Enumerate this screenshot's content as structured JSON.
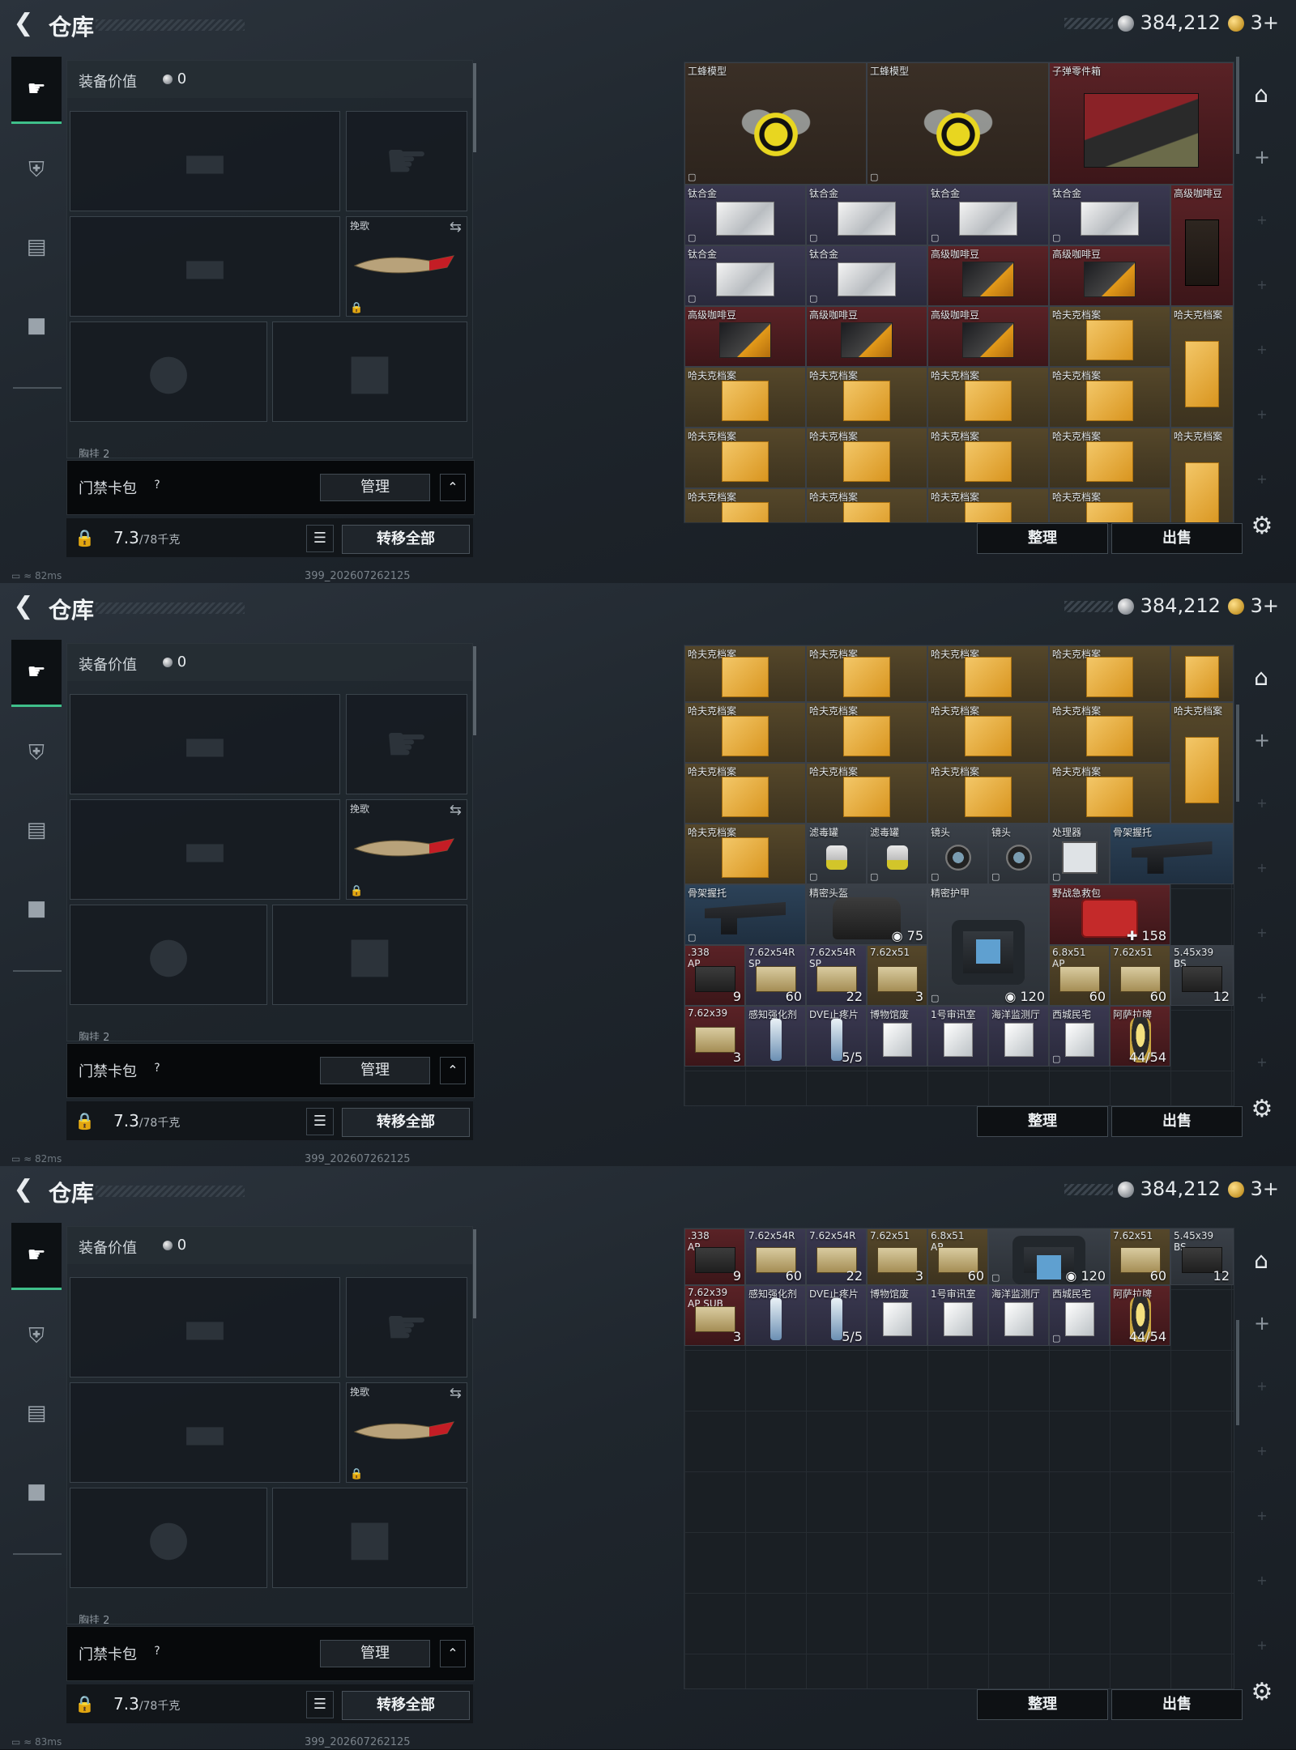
{
  "header": {
    "title": "仓库",
    "silver": "384,212",
    "gold": "3+"
  },
  "loadout": {
    "value_label": "装备价值",
    "value": "0",
    "melee_label": "挽歌",
    "partial_label": "胸挂 2"
  },
  "card_bar": {
    "label": "门禁卡包",
    "help": "?",
    "manage": "管理"
  },
  "capacity": {
    "value": "7.3",
    "max": "/78千克",
    "transfer_all": "转移全部"
  },
  "footer": {
    "sort": "整理",
    "sell": "出售"
  },
  "status": {
    "ping_1": "82ms",
    "ping_2": "82ms",
    "ping_3": "83ms",
    "build": "399_202607262125"
  },
  "names": {
    "wasp": "工蜂模型",
    "parts": "子弹零件箱",
    "titanium": "钛合金",
    "coffee": "高级咖啡豆",
    "dossier": "哈夫克档案",
    "filter": "滤毒罐",
    "lens": "镜头",
    "processor": "处理器",
    "stock": "骨架握托",
    "helmet": "精密头盔",
    "vest": "精密护甲",
    "medkit": "野战急救包",
    "ammo_338": ".338",
    "ap": "AP",
    "ammo_76254": "7.62x54R",
    "sp": "SP",
    "ammo_76251": "7.62x51",
    "ammo_68": "6.8x51",
    "ammo_545": "5.45x39",
    "bs": "BS",
    "ammo_76239": "7.62x39",
    "ap_sub": "AP SUB",
    "stim": "感知强化剂",
    "painkiller": "DVE止疼片",
    "museum": "博物馆废",
    "room1": "1号审讯室",
    "ocean": "海洋监测厅",
    "westcity": "西城民宅",
    "asala": "阿萨拉牌"
  },
  "quantities": {
    "q_9": "9",
    "q_60": "60",
    "q_22": "22",
    "q_3": "3",
    "q_12": "12",
    "q_5_5": "5/5",
    "q_44_54": "44/54",
    "helmet_dur": "75",
    "vest_dur": "120",
    "medkit_dur": "158"
  },
  "colors": {
    "accent": "#3fbf8a",
    "rarity_red": "#5a2226",
    "rarity_purple": "#3a3850",
    "rarity_gold": "#55472a",
    "rarity_blue": "#2c4258"
  }
}
